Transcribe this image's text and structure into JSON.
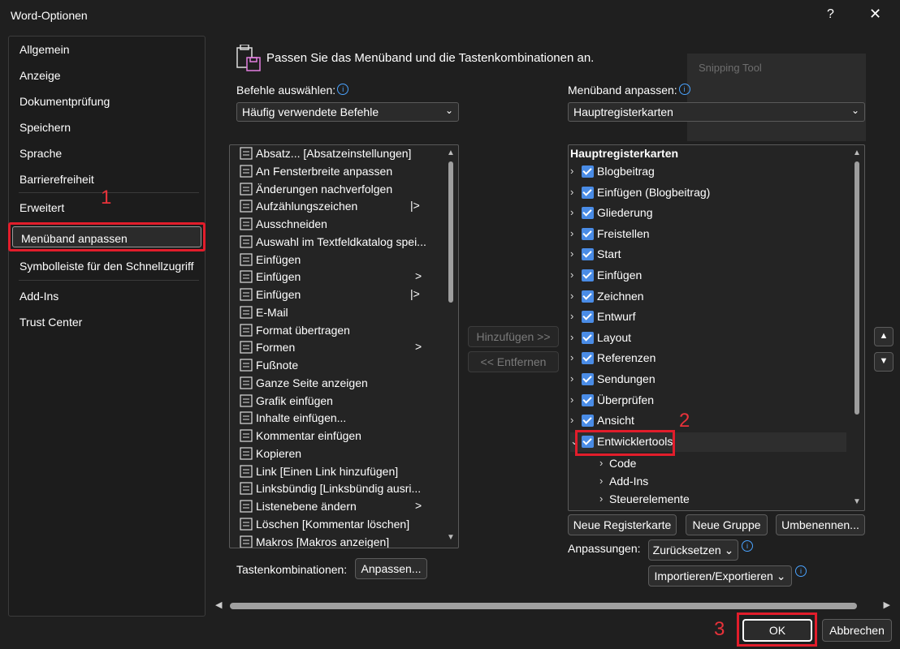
{
  "window": {
    "title": "Word-Optionen",
    "help": "?",
    "close": "✕"
  },
  "sidebar": {
    "items": [
      "Allgemein",
      "Anzeige",
      "Dokumentprüfung",
      "Speichern",
      "Sprache",
      "Barrierefreiheit",
      "Erweitert",
      "Menüband anpassen",
      "Symbolleiste für den Schnellzugriff",
      "Add-Ins",
      "Trust Center"
    ],
    "selected": "Menüband anpassen"
  },
  "annotations": {
    "one": "1",
    "two": "2",
    "three": "3"
  },
  "header": {
    "text": "Passen Sie das Menüband und die Tastenkombinationen an."
  },
  "left": {
    "label": "Befehle auswählen:",
    "select_value": "Häufig verwendete Befehle",
    "commands": [
      {
        "label": "Absatz... [Absatzeinstellungen]",
        "sub": ""
      },
      {
        "label": "An Fensterbreite anpassen",
        "sub": ""
      },
      {
        "label": "Änderungen nachverfolgen",
        "sub": ""
      },
      {
        "label": "Aufzählungszeichen",
        "sub": "|>"
      },
      {
        "label": "Ausschneiden",
        "sub": ""
      },
      {
        "label": "Auswahl im Textfeldkatalog spei...",
        "sub": ""
      },
      {
        "label": "Einfügen",
        "sub": ""
      },
      {
        "label": "Einfügen",
        "sub": ">"
      },
      {
        "label": "Einfügen",
        "sub": "|>"
      },
      {
        "label": "E-Mail",
        "sub": ""
      },
      {
        "label": "Format übertragen",
        "sub": ""
      },
      {
        "label": "Formen",
        "sub": ">"
      },
      {
        "label": "Fußnote",
        "sub": ""
      },
      {
        "label": "Ganze Seite anzeigen",
        "sub": ""
      },
      {
        "label": "Grafik einfügen",
        "sub": ""
      },
      {
        "label": "Inhalte einfügen...",
        "sub": ""
      },
      {
        "label": "Kommentar einfügen",
        "sub": ""
      },
      {
        "label": "Kopieren",
        "sub": ""
      },
      {
        "label": "Link [Einen Link hinzufügen]",
        "sub": ""
      },
      {
        "label": "Linksbündig [Linksbündig ausri...",
        "sub": ""
      },
      {
        "label": "Listenebene ändern",
        "sub": ">"
      },
      {
        "label": "Löschen [Kommentar löschen]",
        "sub": ""
      },
      {
        "label": "Makros [Makros anzeigen]",
        "sub": ""
      }
    ],
    "keyboard_label": "Tastenkombinationen:",
    "customize_button": "Anpassen..."
  },
  "middle": {
    "add_button": "Hinzufügen >>",
    "remove_button": "<< Entfernen"
  },
  "right": {
    "label": "Menüband anpassen:",
    "select_value": "Hauptregisterkarten",
    "tree_header": "Hauptregisterkarten",
    "tabs": [
      "Blogbeitrag",
      "Einfügen (Blogbeitrag)",
      "Gliederung",
      "Freistellen",
      "Start",
      "Einfügen",
      "Zeichnen",
      "Entwurf",
      "Layout",
      "Referenzen",
      "Sendungen",
      "Überprüfen",
      "Ansicht",
      "Entwicklertools"
    ],
    "subgroups": [
      "Code",
      "Add-Ins",
      "Steuerelemente"
    ],
    "new_tab_button": "Neue Registerkarte",
    "new_group_button": "Neue Gruppe",
    "rename_button": "Umbenennen...",
    "customizations_label": "Anpassungen:",
    "reset_button": "Zurücksetzen ⌄",
    "import_export_button": "Importieren/Exportieren ⌄"
  },
  "overlay": {
    "snipping_tool": "Snipping Tool"
  },
  "footer": {
    "ok": "OK",
    "cancel": "Abbrechen"
  },
  "colors": {
    "accent": "#4a8ce6",
    "highlight": "#e21d2b",
    "background": "#1f1f1f"
  }
}
